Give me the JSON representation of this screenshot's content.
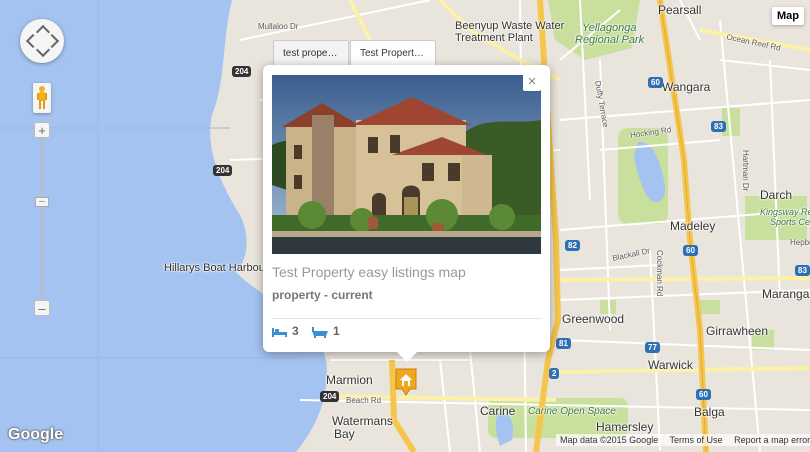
{
  "map": {
    "type_button": "Map",
    "places": [
      {
        "name": "Mullaloo Dr",
        "cls": "road"
      },
      {
        "name": "Beenyup Waste Water",
        "cls": ""
      },
      {
        "name": "Treatment Plant",
        "cls": ""
      },
      {
        "name": "Yellagonga",
        "cls": "green"
      },
      {
        "name": "Regional Park",
        "cls": "green"
      },
      {
        "name": "Pearsall",
        "cls": "big"
      },
      {
        "name": "Ocean Reef Rd",
        "cls": "road"
      },
      {
        "name": "Wangara",
        "cls": "big"
      },
      {
        "name": "Darch",
        "cls": "big"
      },
      {
        "name": "Kingsway Regional",
        "cls": "green"
      },
      {
        "name": "Sports Cen",
        "cls": "green"
      },
      {
        "name": "Madeley",
        "cls": "big"
      },
      {
        "name": "Hillarys Boat Harbour",
        "cls": ""
      },
      {
        "name": "Marangar",
        "cls": "big"
      },
      {
        "name": "Greenwood",
        "cls": "big"
      },
      {
        "name": "Girrawheen",
        "cls": "big"
      },
      {
        "name": "Warwick",
        "cls": "big"
      },
      {
        "name": "Marmion",
        "cls": "big"
      },
      {
        "name": "Beach Rd",
        "cls": "road"
      },
      {
        "name": "Watermans",
        "cls": "big"
      },
      {
        "name": "Bay",
        "cls": "big"
      },
      {
        "name": "Carine",
        "cls": "big"
      },
      {
        "name": "Carine Open Space",
        "cls": "green"
      },
      {
        "name": "Hamersley",
        "cls": "big"
      },
      {
        "name": "Balga",
        "cls": "big"
      },
      {
        "name": "Hocking Rd",
        "cls": "road"
      },
      {
        "name": "Hartman Dr",
        "cls": "road"
      },
      {
        "name": "Blackall Dr",
        "cls": "road"
      },
      {
        "name": "Cockman Rd",
        "cls": "road"
      },
      {
        "name": "Duffy Terrace",
        "cls": "road"
      },
      {
        "name": "Hepburn",
        "cls": "road"
      }
    ],
    "shields": [
      "204",
      "204",
      "204",
      "60",
      "60",
      "60",
      "83",
      "83",
      "82",
      "81",
      "77",
      "2",
      "60"
    ],
    "footer": {
      "attribution": "Map data ©2015 Google",
      "terms": "Terms of Use",
      "report": "Report a map error"
    },
    "logo": "Google"
  },
  "popup": {
    "tabs": [
      "test property...",
      "Test Property..."
    ],
    "title": "Test Property easy listings map",
    "subtitle": "property - current",
    "bedrooms": "3",
    "bathrooms": "1",
    "close_icon": "×"
  },
  "colors": {
    "water": "#a5c3f0",
    "land": "#e9e5dc",
    "park": "#c9df9e",
    "highway": "#f6c64c",
    "accent_marker": "#f0a71e"
  }
}
